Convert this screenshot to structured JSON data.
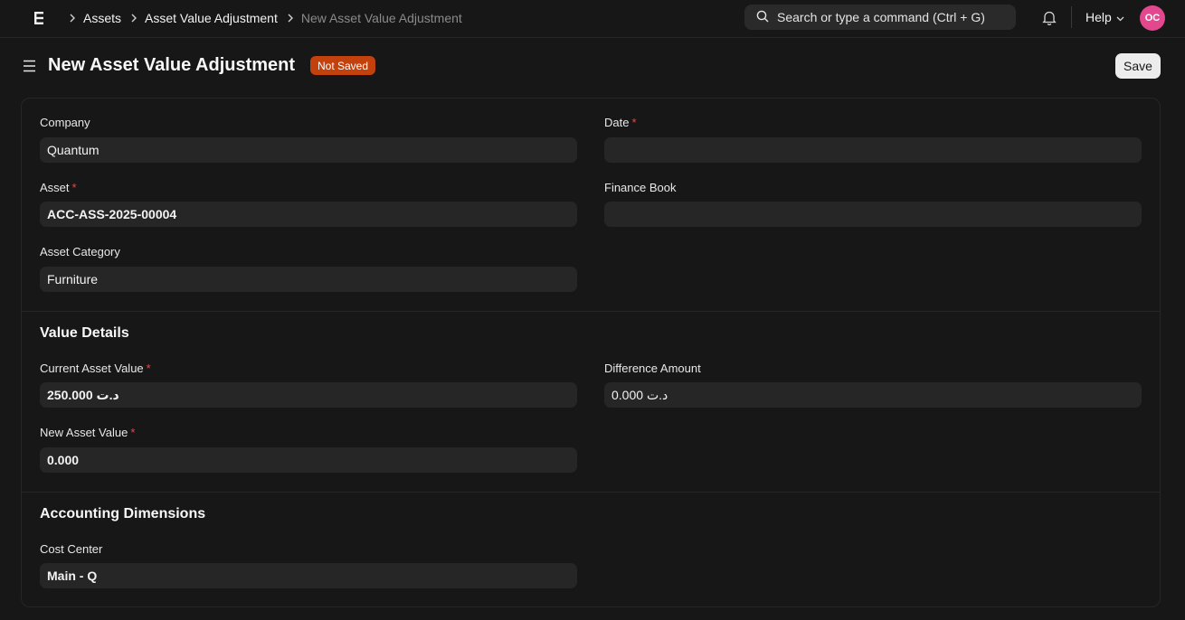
{
  "breadcrumbs": [
    "Assets",
    "Asset Value Adjustment",
    "New Asset Value Adjustment"
  ],
  "search": {
    "placeholder": "Search or type a command (Ctrl + G)"
  },
  "nav": {
    "help_label": "Help",
    "avatar_initials": "OC"
  },
  "page": {
    "title": "New Asset Value Adjustment",
    "status": "Not Saved",
    "save_label": "Save"
  },
  "form": {
    "company": {
      "label": "Company",
      "value": "Quantum"
    },
    "date": {
      "label": "Date",
      "required_mark": "*",
      "value": ""
    },
    "asset": {
      "label": "Asset",
      "required_mark": "*",
      "value": "ACC-ASS-2025-00004"
    },
    "finance_book": {
      "label": "Finance Book",
      "value": ""
    },
    "asset_category": {
      "label": "Asset Category",
      "value": "Furniture"
    },
    "value_details": {
      "title": "Value Details",
      "current_asset_value": {
        "label": "Current Asset Value",
        "required_mark": "*",
        "value": "250.000 د.ت"
      },
      "difference_amount": {
        "label": "Difference Amount",
        "value": "0.000 د.ت"
      },
      "new_asset_value": {
        "label": "New Asset Value",
        "required_mark": "*",
        "value": "0.000"
      }
    },
    "accounting_dimensions": {
      "title": "Accounting Dimensions",
      "cost_center": {
        "label": "Cost Center",
        "value": "Main - Q"
      }
    }
  },
  "colors": {
    "badge": "#c2410c",
    "avatar": "#e3488e",
    "required": "#e5484d"
  }
}
